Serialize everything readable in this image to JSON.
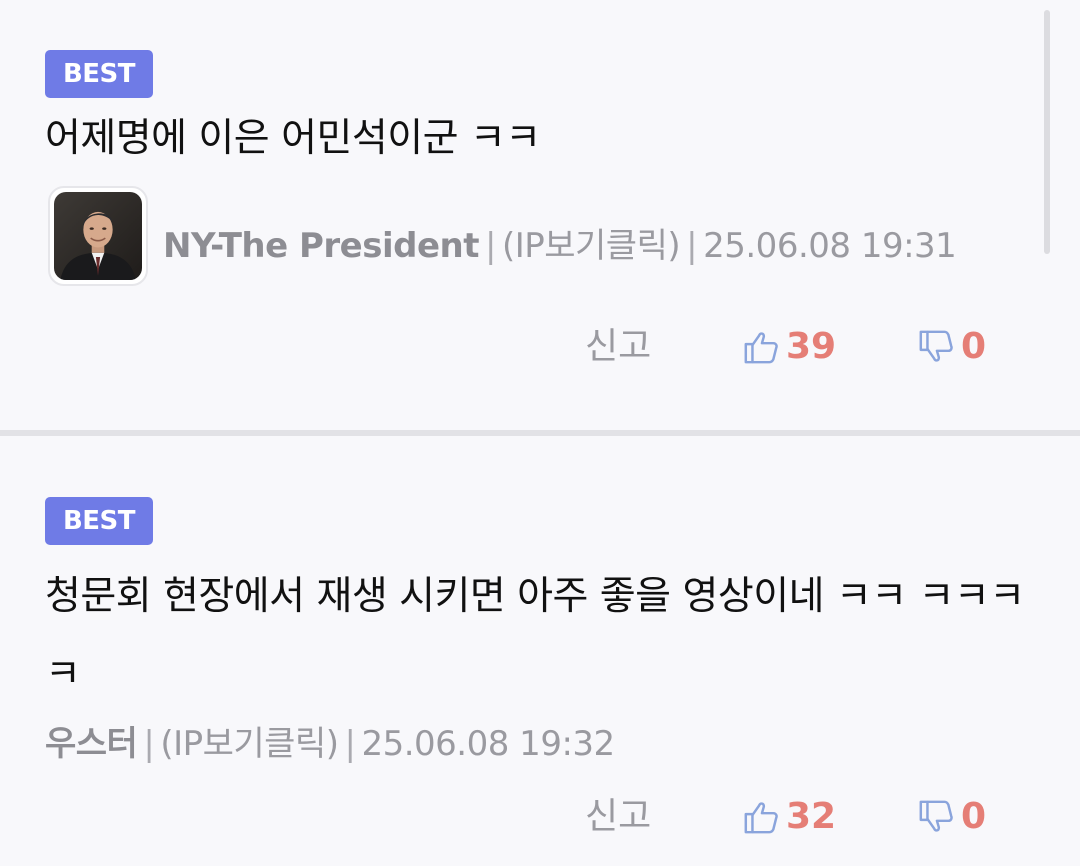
{
  "comments": [
    {
      "badge": "BEST",
      "text": "어제명에 이은 어민석이군 ㅋㅋ",
      "author": "NY-The President",
      "ip": "(IP보기클릭)",
      "datetime": "25.06.08 19:31",
      "report": "신고",
      "upvotes": "39",
      "downvotes": "0",
      "has_avatar": true
    },
    {
      "badge": "BEST",
      "text": "청문회 현장에서 재생 시키면 아주 좋을 영상이네 ㅋㅋ ㅋㅋㅋㅋ",
      "author": "우스터",
      "ip": "(IP보기클릭)",
      "datetime": "25.06.08 19:32",
      "report": "신고",
      "upvotes": "32",
      "downvotes": "0",
      "has_avatar": false
    }
  ],
  "colors": {
    "badge": "#6f7be6",
    "vote_count": "#e57e76",
    "vote_icon": "#8aa4dc",
    "meta": "#9a9aa0",
    "background": "#f8f8fb"
  },
  "icons": {
    "upvote": "thumbs-up-icon",
    "downvote": "thumbs-down-icon"
  }
}
